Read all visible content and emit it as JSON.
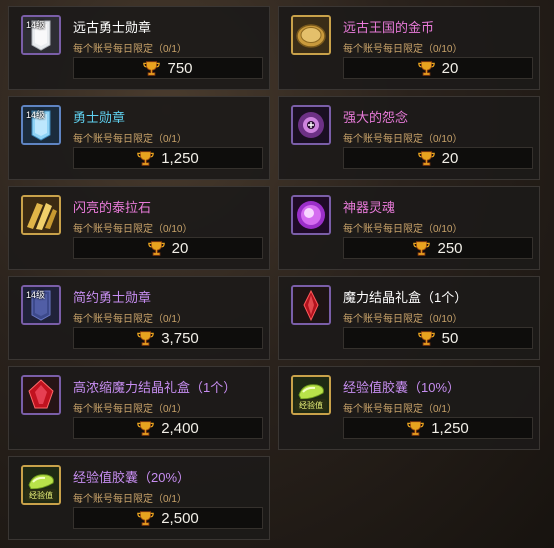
{
  "items": [
    {
      "name": "远古勇士勋章",
      "limit": "每个账号每日限定（0/1）",
      "price": "750",
      "level": "14级",
      "icon": "silver-banner-icon"
    },
    {
      "name": "远古王国的金币",
      "limit": "每个账号每日限定（0/10）",
      "price": "20",
      "level": "",
      "icon": "gold-coin-icon"
    },
    {
      "name": "勇士勋章",
      "limit": "每个账号每日限定（0/1）",
      "price": "1,250",
      "level": "14级",
      "icon": "blue-banner-icon"
    },
    {
      "name": "强大的怨念",
      "limit": "每个账号每日限定（0/10）",
      "price": "20",
      "level": "",
      "icon": "dark-orb-icon"
    },
    {
      "name": "闪亮的泰拉石",
      "limit": "每个账号每日限定（0/10）",
      "price": "20",
      "level": "",
      "icon": "tera-stone-icon"
    },
    {
      "name": "神器灵魂",
      "limit": "每个账号每日限定（0/10）",
      "price": "250",
      "level": "",
      "icon": "artifact-soul-icon"
    },
    {
      "name": "简约勇士勋章",
      "limit": "每个账号每日限定（0/1）",
      "price": "3,750",
      "level": "14级",
      "icon": "dark-banner-icon"
    },
    {
      "name": "魔力结晶礼盒（1个）",
      "limit": "每个账号每日限定（0/10）",
      "price": "50",
      "level": "",
      "icon": "red-crystal-icon"
    },
    {
      "name": "高浓缩魔力结晶礼盒（1个）",
      "limit": "每个账号每日限定（0/1）",
      "price": "2,400",
      "level": "",
      "icon": "big-red-crystal-icon"
    },
    {
      "name": "经验值胶囊（10%）",
      "limit": "每个账号每日限定（0/1）",
      "price": "1,250",
      "level": "",
      "icon": "exp-capsule-icon",
      "icon_text": "经验值"
    },
    {
      "name": "经验值胶囊（20%）",
      "limit": "每个账号每日限定（0/1）",
      "price": "2,500",
      "level": "",
      "icon": "exp-capsule-icon",
      "icon_text": "经验值"
    }
  ],
  "colors": {
    "name_white": "#ffffff",
    "name_cyan": "#5fd0ef",
    "name_pink": "#e77ad8",
    "name_purple": "#c68df0",
    "limit": "#c9a36a",
    "price": "#f2efe8"
  }
}
